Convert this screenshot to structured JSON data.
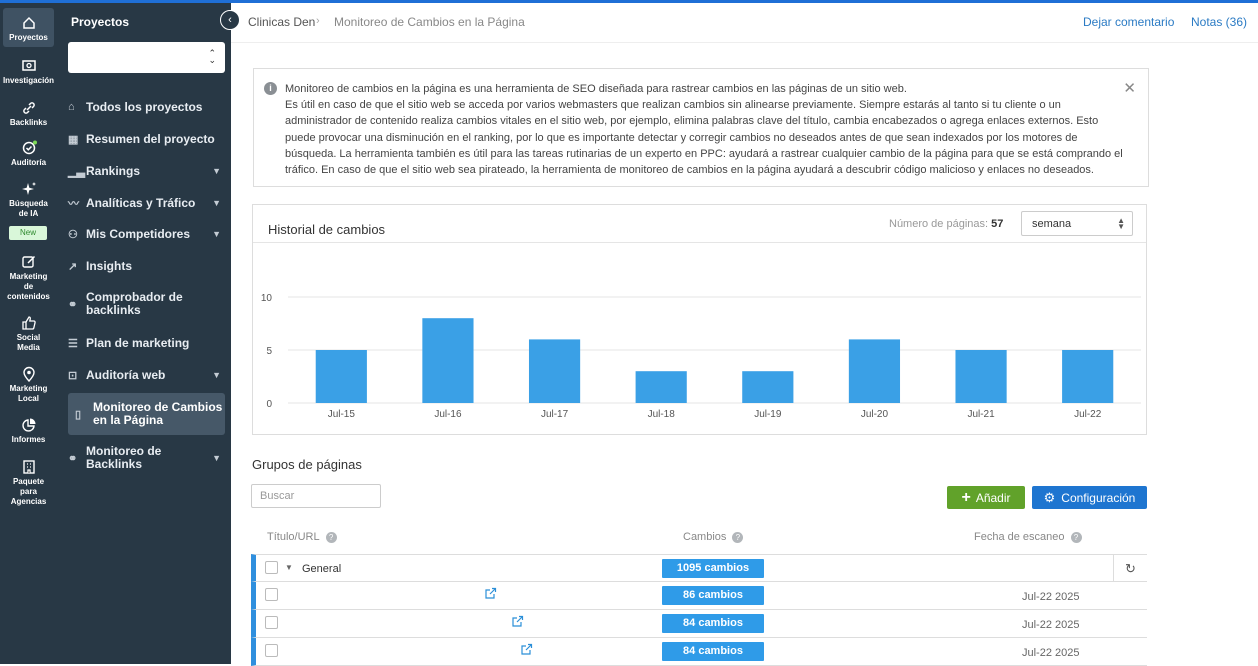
{
  "rail": {
    "items": [
      {
        "label": "Proyectos",
        "icon": "home-icon"
      },
      {
        "label": "Investigación",
        "icon": "research-icon"
      },
      {
        "label": "Backlinks",
        "icon": "link-icon"
      },
      {
        "label": "Auditoría",
        "icon": "audit-icon"
      },
      {
        "label": "Búsqueda de IA",
        "icon": "sparkle-icon"
      },
      {
        "label": "Marketing de contenidos",
        "icon": "edit-icon"
      },
      {
        "label": "Social Media",
        "icon": "thumbs-up-icon"
      },
      {
        "label": "Marketing Local",
        "icon": "location-pin-icon"
      },
      {
        "label": "Informes",
        "icon": "pie-chart-icon"
      },
      {
        "label": "Paquete para Agencias",
        "icon": "building-icon"
      }
    ],
    "new_badge": "New"
  },
  "sidebar": {
    "title": "Proyectos",
    "select_value": "",
    "items": [
      {
        "label": "Todos los proyectos",
        "icon": "home-icon",
        "has_caret": false
      },
      {
        "label": "Resumen del proyecto",
        "icon": "grid-icon",
        "has_caret": false
      },
      {
        "label": "Rankings",
        "icon": "bar-chart-icon",
        "has_caret": true
      },
      {
        "label": "Analíticas y Tráfico",
        "icon": "traffic-icon",
        "has_caret": true
      },
      {
        "label": "Mis Competidores",
        "icon": "users-icon",
        "has_caret": true
      },
      {
        "label": "Insights",
        "icon": "trend-icon",
        "has_caret": false
      },
      {
        "label": "Comprobador de backlinks",
        "icon": "link-icon",
        "has_caret": false
      },
      {
        "label": "Plan de marketing",
        "icon": "checklist-icon",
        "has_caret": false
      },
      {
        "label": "Auditoría web",
        "icon": "audit-icon",
        "has_caret": true
      },
      {
        "label": "Monitoreo de Cambios en la Página",
        "icon": "page-icon",
        "has_caret": false
      },
      {
        "label": "Monitoreo de Backlinks",
        "icon": "link-icon",
        "has_caret": true
      }
    ]
  },
  "breadcrumb": {
    "project": "Clinicas Den",
    "page": "Monitoreo de Cambios en la Página"
  },
  "top_links": {
    "comment": "Dejar comentario",
    "notes": "Notas (36)"
  },
  "info": {
    "line1": "Monitoreo de cambios en la página es una herramienta de SEO diseñada para rastrear cambios en las páginas de un sitio web.",
    "line2": "Es útil en caso de que el sitio web se acceda por varios webmasters que realizan cambios sin alinearse previamente. Siempre estarás al tanto si tu cliente o un administrador de contenido realiza cambios vitales en el sitio web, por ejemplo, elimina palabras clave del título, cambia encabezados o agrega enlaces externos. Esto puede provocar una disminución en el ranking, por lo que es importante detectar y corregir cambios no deseados antes de que sean indexados por los motores de búsqueda. La herramienta también es útil para las tareas rutinarias de un experto en PPC: ayudará a rastrear cualquier cambio de la página para que se está comprando el tráfico. En caso de que el sitio web sea pirateado, la herramienta de monitoreo de cambios en la página ayudará a descubrir código malicioso y enlaces no deseados."
  },
  "history": {
    "title": "Historial de cambios",
    "pages_label": "Número de páginas:",
    "pages_value": "57",
    "period": "semana"
  },
  "chart_data": {
    "type": "bar",
    "categories": [
      "Jul-15",
      "Jul-16",
      "Jul-17",
      "Jul-18",
      "Jul-19",
      "Jul-20",
      "Jul-21",
      "Jul-22"
    ],
    "values": [
      5,
      8,
      6,
      3,
      3,
      6,
      5,
      5
    ],
    "yticks": [
      "0",
      "5",
      "10"
    ],
    "ylim": [
      0,
      10
    ],
    "color": "#3aa0e6",
    "grid": true
  },
  "groups": {
    "title": "Grupos de páginas",
    "search_placeholder": "Buscar",
    "add_label": "Añadir",
    "config_label": "Configuración",
    "col_title": "Título/URL",
    "col_changes": "Cambios",
    "col_date": "Fecha de escaneo",
    "group_name": "General",
    "group_changes": "1095 cambios",
    "rows": [
      {
        "changes": "86 cambios",
        "date": "Jul-22 2025"
      },
      {
        "changes": "84 cambios",
        "date": "Jul-22 2025"
      },
      {
        "changes": "84 cambios",
        "date": "Jul-22 2025"
      }
    ]
  },
  "colors": {
    "sidebar_bg": "#283845",
    "accent_blue": "#1e75d0",
    "add_green": "#61a22a",
    "badge_blue": "#2f9be8"
  }
}
